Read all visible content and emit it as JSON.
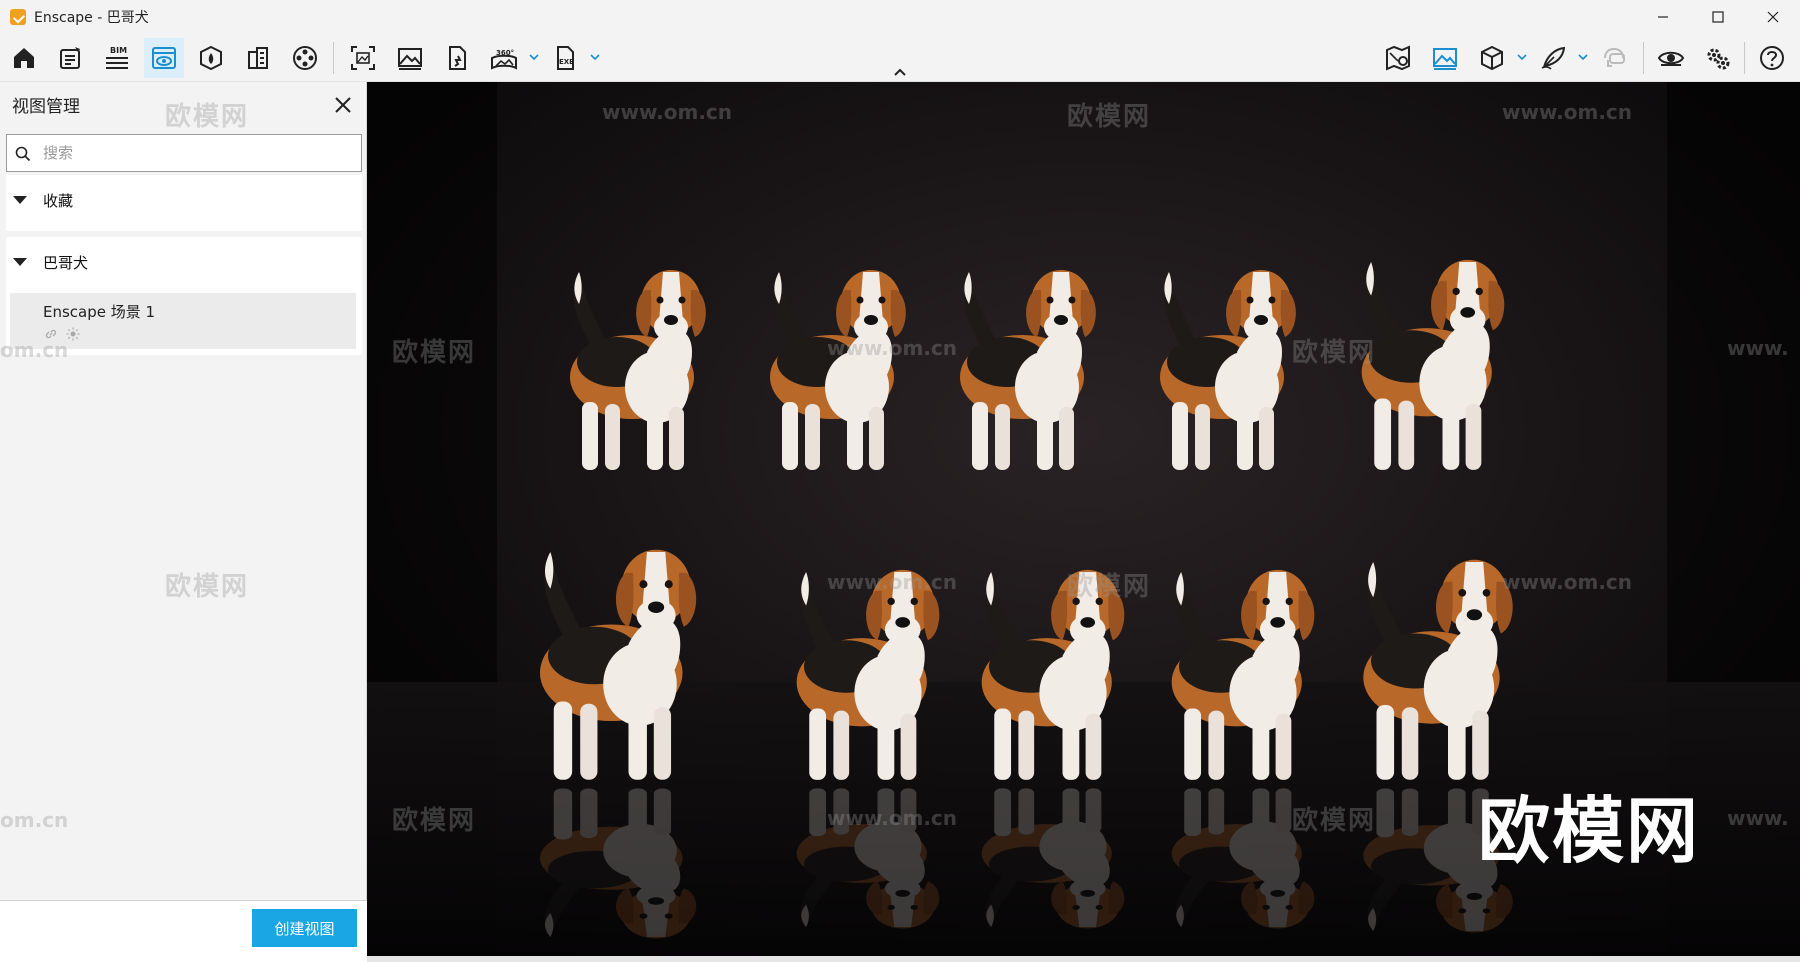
{
  "window": {
    "title": "Enscape - 巴哥犬",
    "controls": [
      "minimize",
      "maximize",
      "close"
    ]
  },
  "toolbar": {
    "left_icons": [
      "home-icon",
      "settings-sheet-icon",
      "bim-icon",
      "view-management-icon",
      "asset-library-icon",
      "buildings-icon",
      "video-reel-icon",
      "screenshot-icon",
      "rendered-image-icon",
      "safe-mode-icon",
      "panorama-360-icon",
      "exe-export-icon"
    ],
    "bim_label": "BIM",
    "pano_label": "360°",
    "exe_label": "EXE",
    "right_icons": [
      "map-pin-icon",
      "image-view-icon",
      "cube-icon",
      "feather-brush-icon",
      "vr-headset-icon",
      "eye-icon",
      "gears-icon",
      "help-icon"
    ],
    "active_icon": "view-management-icon"
  },
  "panel": {
    "title": "视图管理",
    "search_placeholder": "搜索",
    "groups": [
      {
        "title": "收藏",
        "expanded": true,
        "items": []
      },
      {
        "title": "巴哥犬",
        "expanded": true,
        "items": [
          {
            "name": "Enscape 场景 1",
            "icons": [
              "link-icon",
              "sun-icon"
            ]
          }
        ]
      }
    ],
    "create_button": "创建视图"
  },
  "viewport": {
    "watermark_text": "欧模网",
    "watermark_url": "www.om.cn",
    "watermark_big": "欧模网",
    "watermark_edge": "om.cn",
    "watermark_edge_right": "www."
  },
  "colors": {
    "accent": "#1aa6e4",
    "active_tool_bg": "#dbeefa",
    "viewport_bg": "#0c0b0c",
    "dog_tan": "#b8692a",
    "dog_black": "#1e1a18",
    "dog_white": "#f2ece6"
  }
}
